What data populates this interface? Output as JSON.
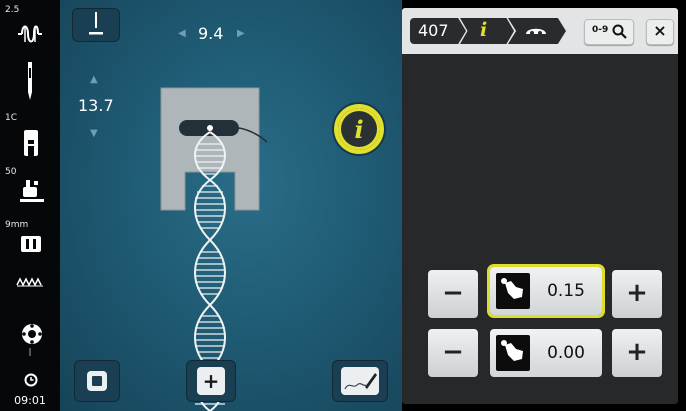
{
  "left_toolbar": {
    "items": [
      {
        "label": "2.5",
        "icon": "stitch-width-icon"
      },
      {
        "label": "",
        "icon": "needle-icon"
      },
      {
        "label": "1C",
        "icon": "presser-foot-icon"
      },
      {
        "label": "50",
        "icon": "foot-pressure-icon"
      },
      {
        "label": "9mm",
        "icon": "stitch-plate-icon"
      },
      {
        "label": "",
        "icon": "feed-dog-icon"
      },
      {
        "label": "",
        "icon": "bobbin-icon"
      }
    ],
    "time": "09:01"
  },
  "stage": {
    "stitch_width": "9.4",
    "stitch_length": "13.7",
    "info_icon_glyph": "i",
    "add_glyph": "+"
  },
  "panel": {
    "breadcrumb": {
      "stitch_number": "407",
      "info_glyph": "i"
    },
    "search_label": "0-9",
    "close_glyph": "×",
    "rows": [
      {
        "value": "0.15",
        "minus": "−",
        "plus": "+",
        "selected": true
      },
      {
        "value": "0.00",
        "minus": "−",
        "plus": "+",
        "selected": false
      }
    ]
  },
  "colors": {
    "accent_yellow": "#e1e02e",
    "stage_blue": "#1f5b74",
    "panel_dark": "#262829",
    "header_light": "#e3e4e5"
  }
}
